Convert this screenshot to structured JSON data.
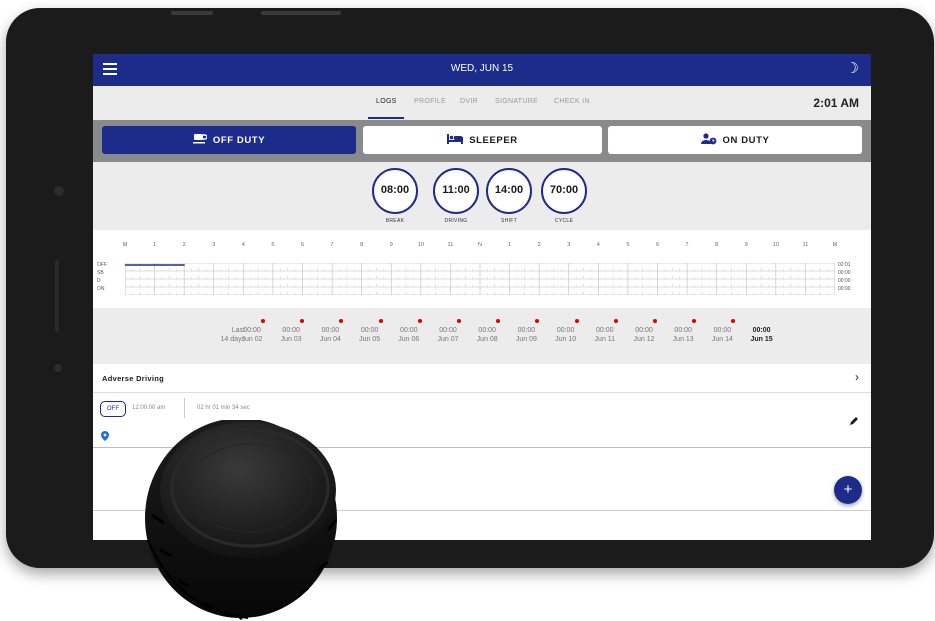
{
  "header": {
    "date": "WED, JUN 15",
    "menu_icon": "hamburger-menu-icon",
    "theme_icon": "moon-icon"
  },
  "tabs": [
    {
      "label": "LOGS",
      "active": true
    },
    {
      "label": "PROFILE",
      "active": false
    },
    {
      "label": "DVIR",
      "active": false
    },
    {
      "label": "SIGNATURE",
      "active": false
    },
    {
      "label": "CHECK IN",
      "active": false
    }
  ],
  "clock": "2:01 AM",
  "status_buttons": [
    {
      "label": "OFF DUTY",
      "icon": "coffee-cup-icon",
      "active": true
    },
    {
      "label": "SLEEPER",
      "icon": "bed-icon",
      "active": false
    },
    {
      "label": "ON DUTY",
      "icon": "driver-clock-icon",
      "active": false
    }
  ],
  "gauges": [
    {
      "value": "08:00",
      "label": "BREAK"
    },
    {
      "value": "11:00",
      "label": "DRIVING"
    },
    {
      "value": "14:00",
      "label": "SHIFT"
    },
    {
      "value": "70:00",
      "label": "CYCLE"
    }
  ],
  "log_grid": {
    "hours": [
      "M",
      "1",
      "2",
      "3",
      "4",
      "5",
      "6",
      "7",
      "8",
      "9",
      "10",
      "11",
      "N",
      "1",
      "2",
      "3",
      "4",
      "5",
      "6",
      "7",
      "8",
      "9",
      "10",
      "11",
      "M"
    ],
    "rows": [
      "OFF",
      "SB",
      "D",
      "ON"
    ],
    "totals": [
      "02:01",
      "00:00",
      "00:00",
      "00:00"
    ],
    "accent_color": "#1d2b8a"
  },
  "history": {
    "label_line1": "Last",
    "label_line2": "14 days",
    "days": [
      {
        "time": "00:00",
        "date": "Jun 02",
        "flag": true
      },
      {
        "time": "00:00",
        "date": "Jun 03",
        "flag": true
      },
      {
        "time": "00:00",
        "date": "Jun 04",
        "flag": true
      },
      {
        "time": "00:00",
        "date": "Jun 05",
        "flag": true
      },
      {
        "time": "00:00",
        "date": "Jun 06",
        "flag": true
      },
      {
        "time": "00:00",
        "date": "Jun 07",
        "flag": true
      },
      {
        "time": "00:00",
        "date": "Jun 08",
        "flag": true
      },
      {
        "time": "00:00",
        "date": "Jun 09",
        "flag": true
      },
      {
        "time": "00:00",
        "date": "Jun 10",
        "flag": true
      },
      {
        "time": "00:00",
        "date": "Jun 11",
        "flag": true
      },
      {
        "time": "00:00",
        "date": "Jun 12",
        "flag": true
      },
      {
        "time": "00:00",
        "date": "Jun 13",
        "flag": true
      },
      {
        "time": "00:00",
        "date": "Jun 14",
        "flag": true
      },
      {
        "time": "00:00",
        "date": "Jun 15",
        "flag": false,
        "current": true
      }
    ],
    "flag_color": "#e00000"
  },
  "adverse": {
    "label": "Adverse Driving",
    "icon": "chevron-right-icon"
  },
  "log_entry": {
    "status": "OFF",
    "time": "12:00:00 am",
    "duration": "02 hr 01 min 34 sec",
    "location_icon": "map-pin-icon",
    "edit_icon": "pencil-icon"
  },
  "fab": {
    "label": "+",
    "icon": "plus-icon"
  },
  "colors": {
    "primary": "#1d2b8a",
    "background": "#ececec",
    "status_bar": "#8a8a8a"
  }
}
